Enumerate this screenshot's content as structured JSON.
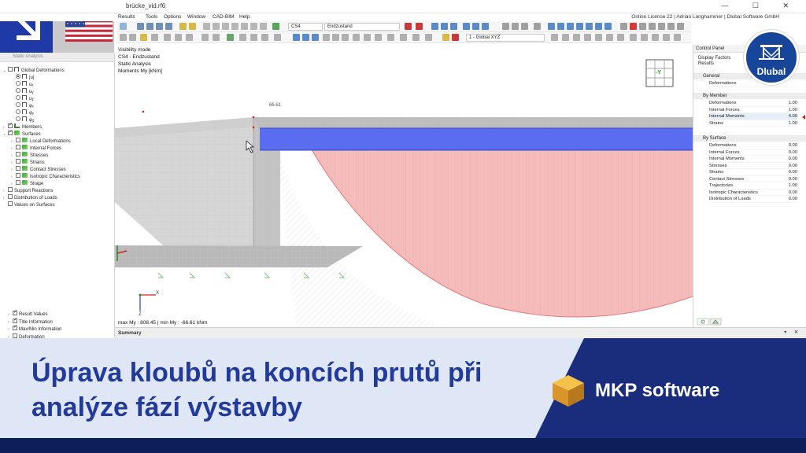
{
  "window": {
    "title": "brücke_vid.rf6",
    "controls": "— ☐ ✕",
    "license": "Online License 22 | Adrian Langhammer | Dlubal Software GmbH"
  },
  "menu": [
    "Results",
    "Tools",
    "Options",
    "Window",
    "CAD-BIM",
    "Help"
  ],
  "toolbar": {
    "load_case_id": "CS4",
    "load_case_name": "Endzustand",
    "coordinate_system": "1 - Global XYZ"
  },
  "navigator": {
    "header": "Static Analysis",
    "items": [
      {
        "label": "Global Deformations",
        "level": 0,
        "expand": "v",
        "check": "box",
        "icon": "deform"
      },
      {
        "label": "|u|",
        "level": 1,
        "expand": "",
        "check": "radio-sel",
        "icon": "deform"
      },
      {
        "label": "uₓ",
        "level": 1,
        "expand": "",
        "check": "radio",
        "icon": "deform"
      },
      {
        "label": "uᵧ",
        "level": 1,
        "expand": "",
        "check": "radio",
        "icon": "deform"
      },
      {
        "label": "u𝓏",
        "level": 1,
        "expand": "",
        "check": "radio",
        "icon": "deform"
      },
      {
        "label": "φₓ",
        "level": 1,
        "expand": "",
        "check": "radio",
        "icon": "deform"
      },
      {
        "label": "φᵧ",
        "level": 1,
        "expand": "",
        "check": "radio",
        "icon": "deform"
      },
      {
        "label": "φ𝓏",
        "level": 1,
        "expand": "",
        "check": "radio",
        "icon": "deform"
      },
      {
        "label": "Members",
        "level": 0,
        "expand": ">",
        "check": "box-checked",
        "icon": "member"
      },
      {
        "label": "Surfaces",
        "level": 0,
        "expand": "v",
        "check": "box-checked",
        "icon": "green"
      },
      {
        "label": "Local Deformations",
        "level": 1,
        "expand": ">",
        "check": "box",
        "icon": "green"
      },
      {
        "label": "Internal Forces",
        "level": 1,
        "expand": ">",
        "check": "box",
        "icon": "green"
      },
      {
        "label": "Stresses",
        "level": 1,
        "expand": ">",
        "check": "box",
        "icon": "green"
      },
      {
        "label": "Strains",
        "level": 1,
        "expand": ">",
        "check": "box",
        "icon": "green"
      },
      {
        "label": "Contact Stresses",
        "level": 1,
        "expand": ">",
        "check": "box",
        "icon": "green"
      },
      {
        "label": "Isotropic Characteristics",
        "level": 1,
        "expand": ">",
        "check": "box",
        "icon": "green"
      },
      {
        "label": "Shape",
        "level": 1,
        "expand": ">",
        "check": "box",
        "icon": "green"
      },
      {
        "label": "Support Reactions",
        "level": 0,
        "expand": ">",
        "check": "box",
        "icon": ""
      },
      {
        "label": "Distribution of Loads",
        "level": 0,
        "expand": ">",
        "check": "box",
        "icon": ""
      },
      {
        "label": "Values on Surfaces",
        "level": 0,
        "expand": "",
        "check": "box",
        "icon": ""
      }
    ],
    "bottom_items": [
      {
        "label": "Result Values",
        "check": "box-checked"
      },
      {
        "label": "Title Information",
        "check": "box-checked"
      },
      {
        "label": "Max/Min Information",
        "check": "box-checked"
      },
      {
        "label": "Deformation",
        "check": "box"
      }
    ]
  },
  "view": {
    "info_lines": [
      "Visibility mode",
      "CS4 - Endzustand",
      "Static Analysis",
      "Moments My [kNm]"
    ],
    "annotation": "66.61",
    "cube_label": "-Y",
    "status": "max My : 808.45 | min My : -66.61 kNm",
    "axis_x": "X",
    "axis_z": "Z"
  },
  "summary": {
    "label": "Summary",
    "controls": "▾ ✕"
  },
  "control_panel": {
    "title": "Control Panel",
    "lines": [
      "Display Factors",
      "Results"
    ],
    "sections": [
      {
        "title": "General",
        "rows": [
          {
            "label": "Deformations",
            "value": ""
          }
        ]
      },
      {
        "title": "By Member",
        "rows": [
          {
            "label": "Deformations",
            "value": "1.00"
          },
          {
            "label": "Internal Forces",
            "value": "1.00"
          },
          {
            "label": "Internal Moments",
            "value": "4.00"
          },
          {
            "label": "Strains",
            "value": "1.00"
          }
        ]
      },
      {
        "title": "By Surface",
        "rows": [
          {
            "label": "Deformations",
            "value": "0.00"
          },
          {
            "label": "Internal Forces",
            "value": "0.00"
          },
          {
            "label": "Internal Moments",
            "value": "0.00"
          },
          {
            "label": "Stresses",
            "value": "0.00"
          },
          {
            "label": "Strains",
            "value": "0.00"
          },
          {
            "label": "Contact Stresses",
            "value": "0.00"
          },
          {
            "label": "Trajectories",
            "value": "1.00"
          },
          {
            "label": "Isotropic Characteristics",
            "value": "0.00"
          },
          {
            "label": "Distribution of Loads",
            "value": "0.00"
          }
        ]
      }
    ]
  },
  "badge": {
    "label": "Dlubal",
    "color": "#17459a"
  },
  "banner": {
    "title_line1": "Úprava kloubů na koncích prutů při",
    "title_line2": "analýze fází výstavby",
    "brand": "MKP software",
    "title_color": "#223a9a",
    "bg_color": "#dfe6f5",
    "dark_color": "#1a2d7c"
  }
}
